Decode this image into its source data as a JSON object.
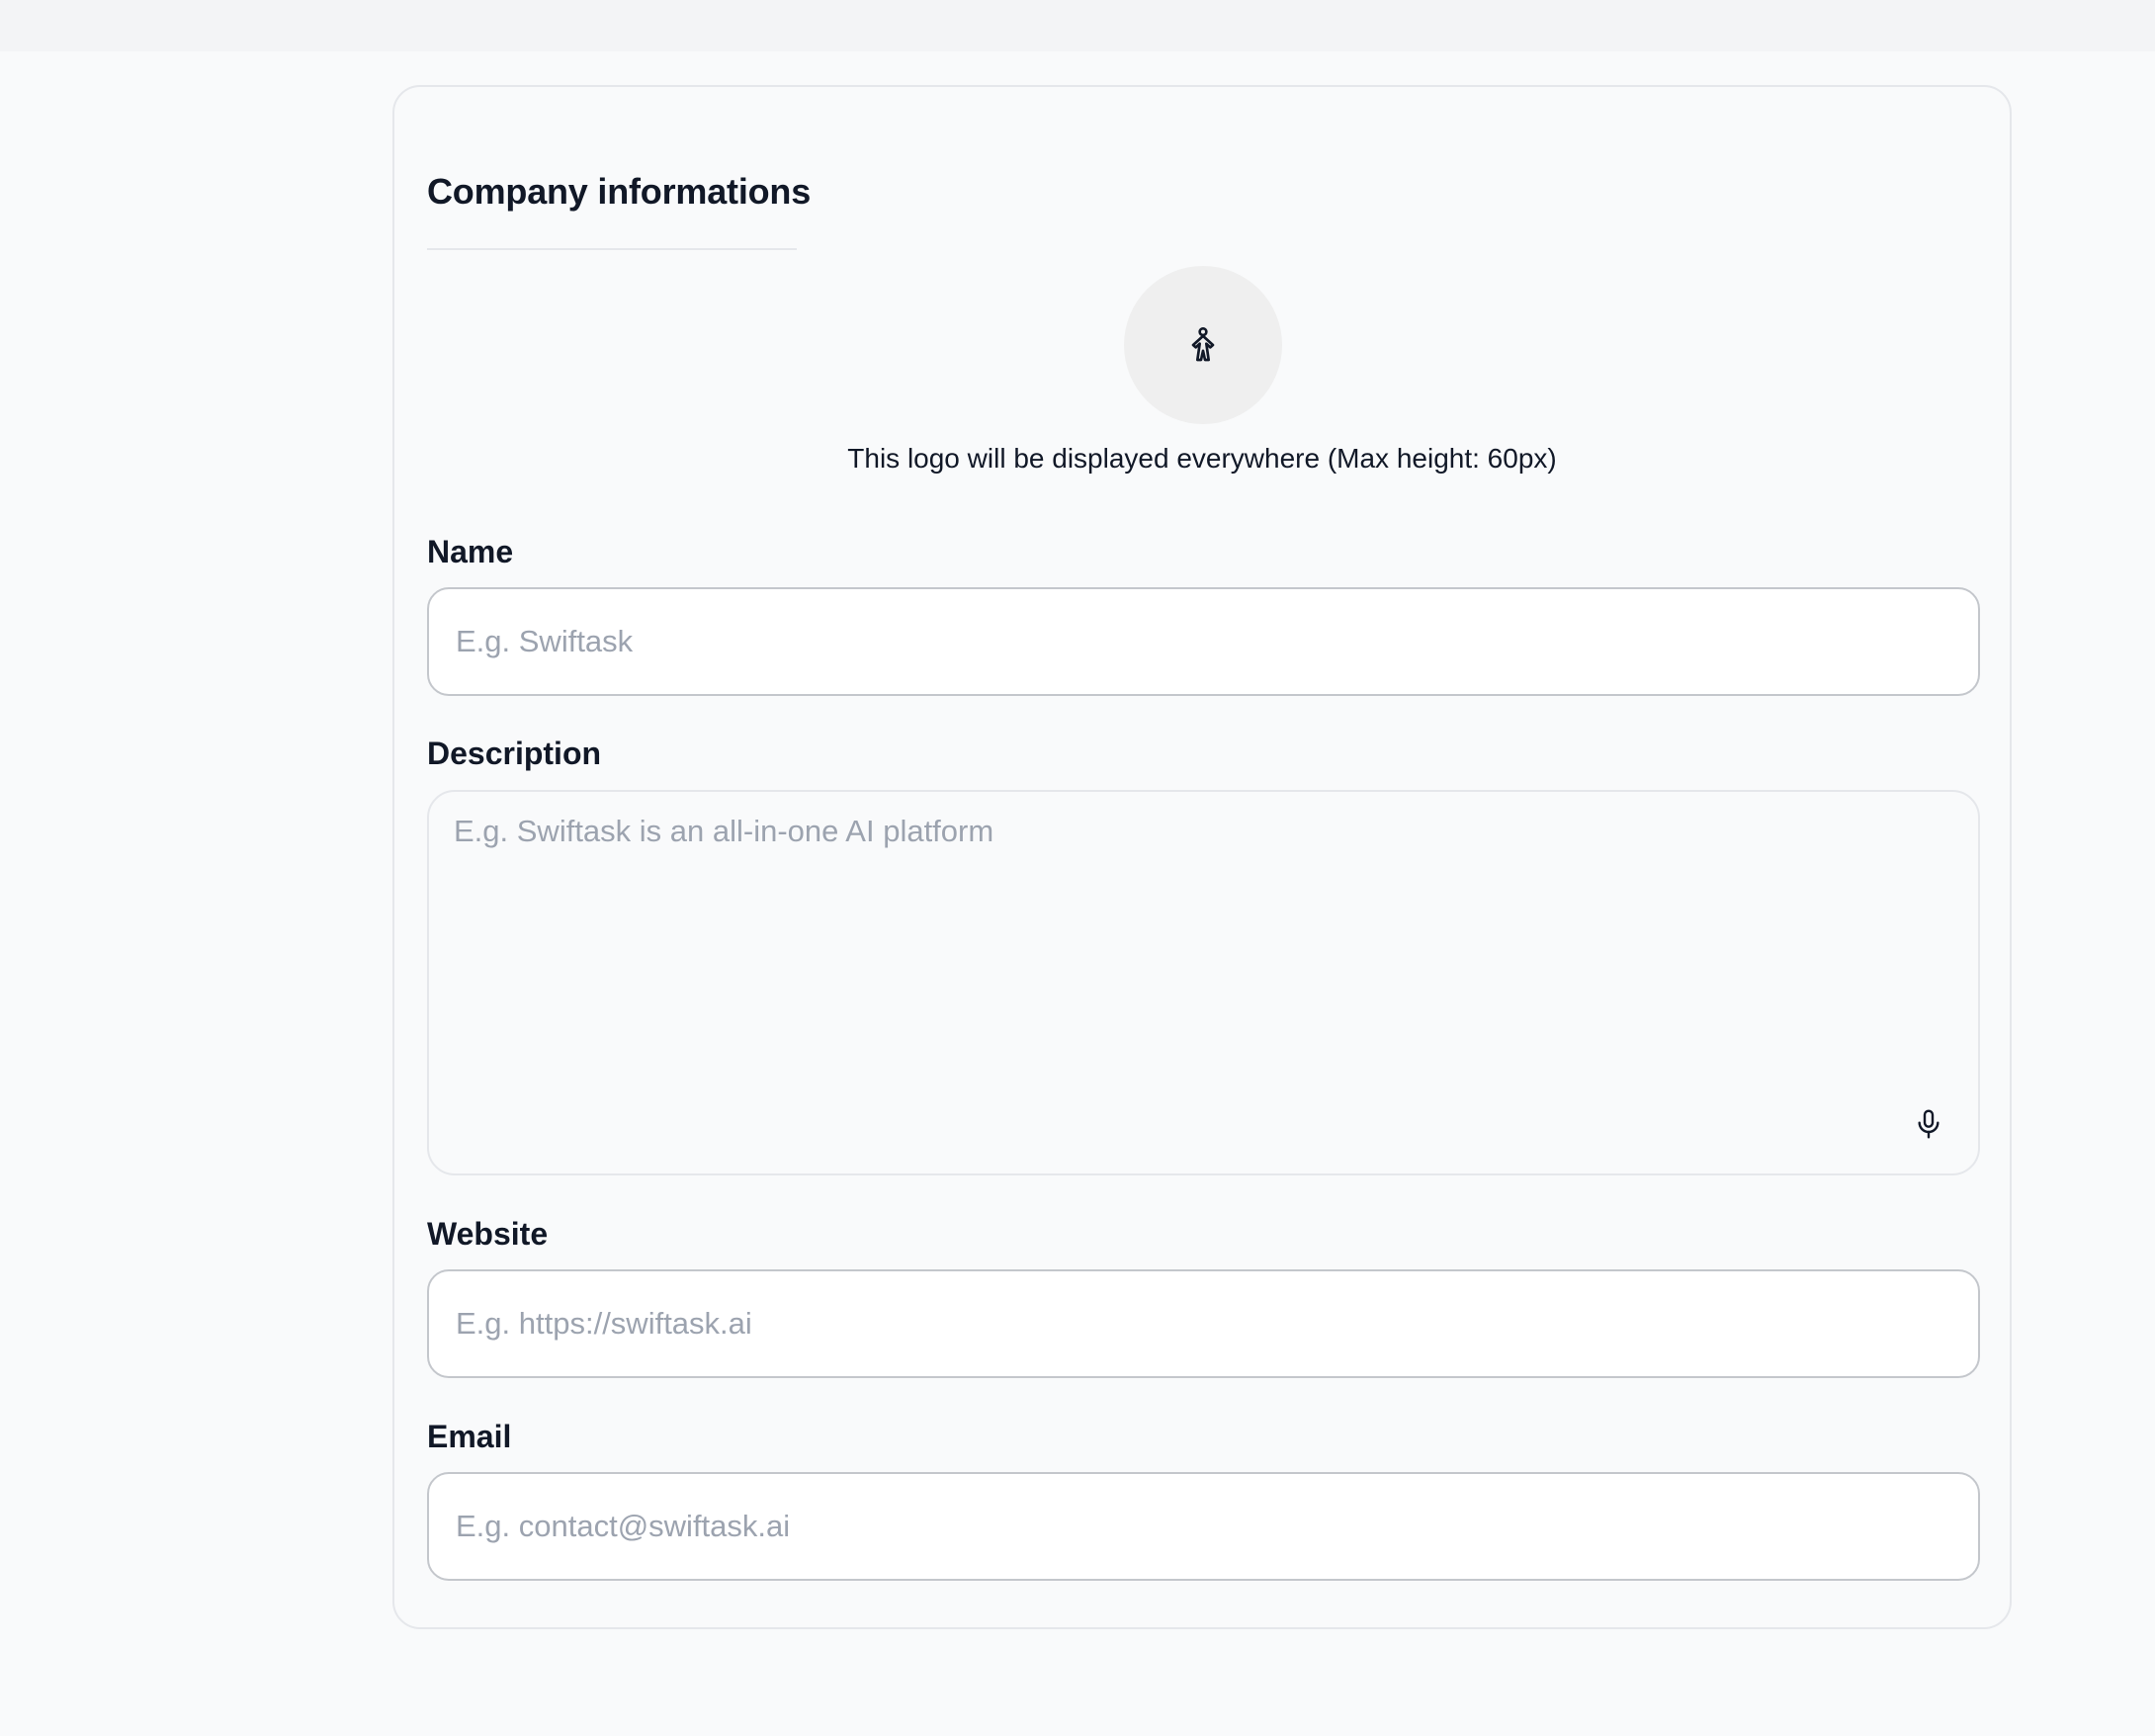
{
  "company_info": {
    "title": "Company informations",
    "logo": {
      "icon": "person-icon",
      "caption": "This logo will be displayed everywhere (Max height: 60px)"
    },
    "fields": {
      "name": {
        "label": "Name",
        "value": "",
        "placeholder": "E.g. Swiftask"
      },
      "description": {
        "label": "Description",
        "value": "",
        "placeholder": "E.g. Swiftask is an all-in-one AI platform",
        "action_icon": "microphone-icon"
      },
      "website": {
        "label": "Website",
        "value": "",
        "placeholder": "E.g. https://swiftask.ai"
      },
      "email": {
        "label": "Email",
        "value": "",
        "placeholder": "E.g. contact@swiftask.ai"
      }
    }
  }
}
